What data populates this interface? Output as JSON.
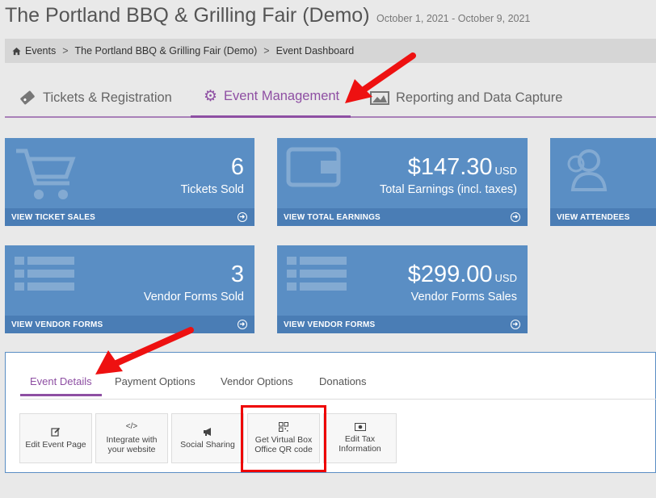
{
  "header": {
    "title": "The Portland BBQ & Grilling Fair (Demo)",
    "dates": "October 1, 2021 - October 9, 2021"
  },
  "breadcrumb": {
    "items": [
      "Events",
      "The Portland BBQ & Grilling Fair (Demo)",
      "Event Dashboard"
    ],
    "separator": ">"
  },
  "main_tabs": [
    {
      "label": "Tickets & Registration",
      "icon": "ticket-icon",
      "active": false
    },
    {
      "label": "Event Management",
      "icon": "gear-icon",
      "active": true
    },
    {
      "label": "Reporting and Data Capture",
      "icon": "chart-icon",
      "active": false
    }
  ],
  "cards": [
    {
      "value": "6",
      "unit": "",
      "label": "Tickets Sold",
      "footer": "VIEW TICKET SALES",
      "icon": "cart-icon"
    },
    {
      "value": "$147.30",
      "unit": "USD",
      "label": "Total Earnings (incl. taxes)",
      "footer": "VIEW TOTAL EARNINGS",
      "icon": "wallet-icon"
    },
    {
      "value": "",
      "unit": "",
      "label": "",
      "footer": "VIEW ATTENDEES",
      "icon": "users-icon"
    },
    {
      "value": "3",
      "unit": "",
      "label": "Vendor Forms Sold",
      "footer": "VIEW VENDOR FORMS",
      "icon": "list-icon"
    },
    {
      "value": "$299.00",
      "unit": "USD",
      "label": "Vendor Forms Sales",
      "footer": "VIEW VENDOR FORMS",
      "icon": "list-icon"
    }
  ],
  "sub_tabs": [
    {
      "label": "Event Details",
      "active": true
    },
    {
      "label": "Payment Options",
      "active": false
    },
    {
      "label": "Vendor Options",
      "active": false
    },
    {
      "label": "Donations",
      "active": false
    }
  ],
  "actions": [
    {
      "line1": "Edit Event Page",
      "line2": "",
      "icon": "edit-icon"
    },
    {
      "line1": "Integrate with",
      "line2": "your website",
      "icon": "code-icon"
    },
    {
      "line1": "Social Sharing",
      "line2": "",
      "icon": "megaphone-icon"
    },
    {
      "line1": "Get Virtual Box",
      "line2": "Office QR code",
      "icon": "qr-code-icon"
    },
    {
      "line1": "Edit Tax",
      "line2": "Information",
      "icon": "money-icon"
    }
  ],
  "colors": {
    "card_bg": "#5a8ec4",
    "card_footer": "#4a7db5",
    "accent_purple": "#8e4fa3",
    "annotation_red": "#ee0000"
  }
}
